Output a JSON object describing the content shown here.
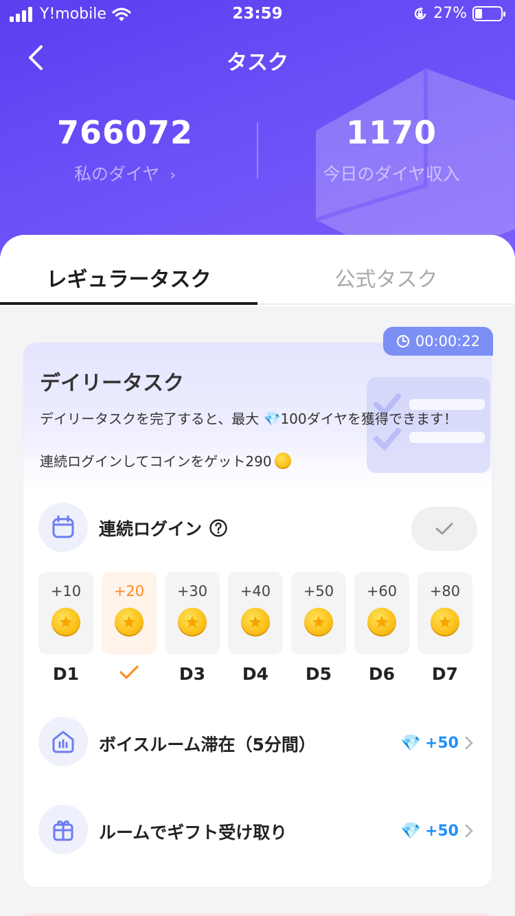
{
  "status": {
    "carrier": "Y!mobile",
    "time": "23:59",
    "battery": "27%",
    "battery_level": 0.27
  },
  "header": {
    "title": "タスク",
    "my_diamonds_value": "766072",
    "my_diamonds_label": "私のダイヤ",
    "today_income_value": "1170",
    "today_income_label": "今日のダイヤ収入"
  },
  "tabs": [
    {
      "label": "レギュラータスク",
      "active": true
    },
    {
      "label": "公式タスク",
      "active": false
    }
  ],
  "daily": {
    "timer": "00:00:22",
    "title": "デイリータスク",
    "description": "デイリータスクを完了すると、最大 💎100ダイヤを獲得できます！",
    "login_bonus_text": "連続ログインしてコインをゲット290"
  },
  "login_row": {
    "label": "連続ログイン",
    "completed": true
  },
  "days": [
    {
      "amount": "+10",
      "label": "D1",
      "checked": false
    },
    {
      "amount": "+20",
      "label": "",
      "checked": true
    },
    {
      "amount": "+30",
      "label": "D3",
      "checked": false
    },
    {
      "amount": "+40",
      "label": "D4",
      "checked": false
    },
    {
      "amount": "+50",
      "label": "D5",
      "checked": false
    },
    {
      "amount": "+60",
      "label": "D6",
      "checked": false
    },
    {
      "amount": "+80",
      "label": "D7",
      "checked": false
    }
  ],
  "tasks": [
    {
      "label": "ボイスルーム滞在（5分間）",
      "reward": "+50",
      "icon": "voice-room-icon"
    },
    {
      "label": "ルームでギフト受け取り",
      "reward": "+50",
      "icon": "gift-icon"
    }
  ],
  "colors": {
    "header_start": "#5a3ef0",
    "header_end": "#7d5cf9",
    "accent_orange": "#ff8a1e",
    "reward_blue": "#1e90ff",
    "timer_bg": "#7b8ff5"
  }
}
